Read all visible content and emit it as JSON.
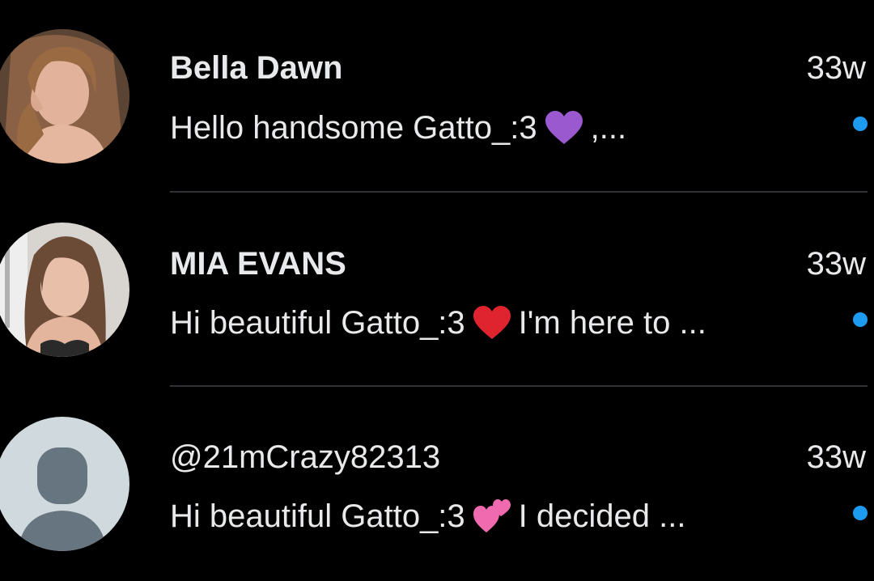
{
  "colors": {
    "background": "#000000",
    "text": "#e7e9ea",
    "unread_dot": "#1d9bf0",
    "divider": "#2f3336",
    "default_avatar_bg": "#cfd9de",
    "default_avatar_fg": "#66757f"
  },
  "conversations": [
    {
      "name": "Bella Dawn",
      "time": "33w",
      "preview_before": "Hello handsome Gatto_:3",
      "emoji": "purple-heart-icon",
      "preview_after": ",...",
      "unread": true,
      "avatar": "photo"
    },
    {
      "name": "MIA EVANS",
      "time": "33w",
      "preview_before": "Hi beautiful Gatto_:3",
      "emoji": "red-heart-icon",
      "preview_after": "I'm here to ...",
      "unread": true,
      "avatar": "photo"
    },
    {
      "name": "@21mCrazy82313",
      "time": "33w",
      "preview_before": "Hi beautiful Gatto_:3",
      "emoji": "two-hearts-icon",
      "preview_after": "I decided ...",
      "unread": true,
      "avatar": "default"
    }
  ]
}
